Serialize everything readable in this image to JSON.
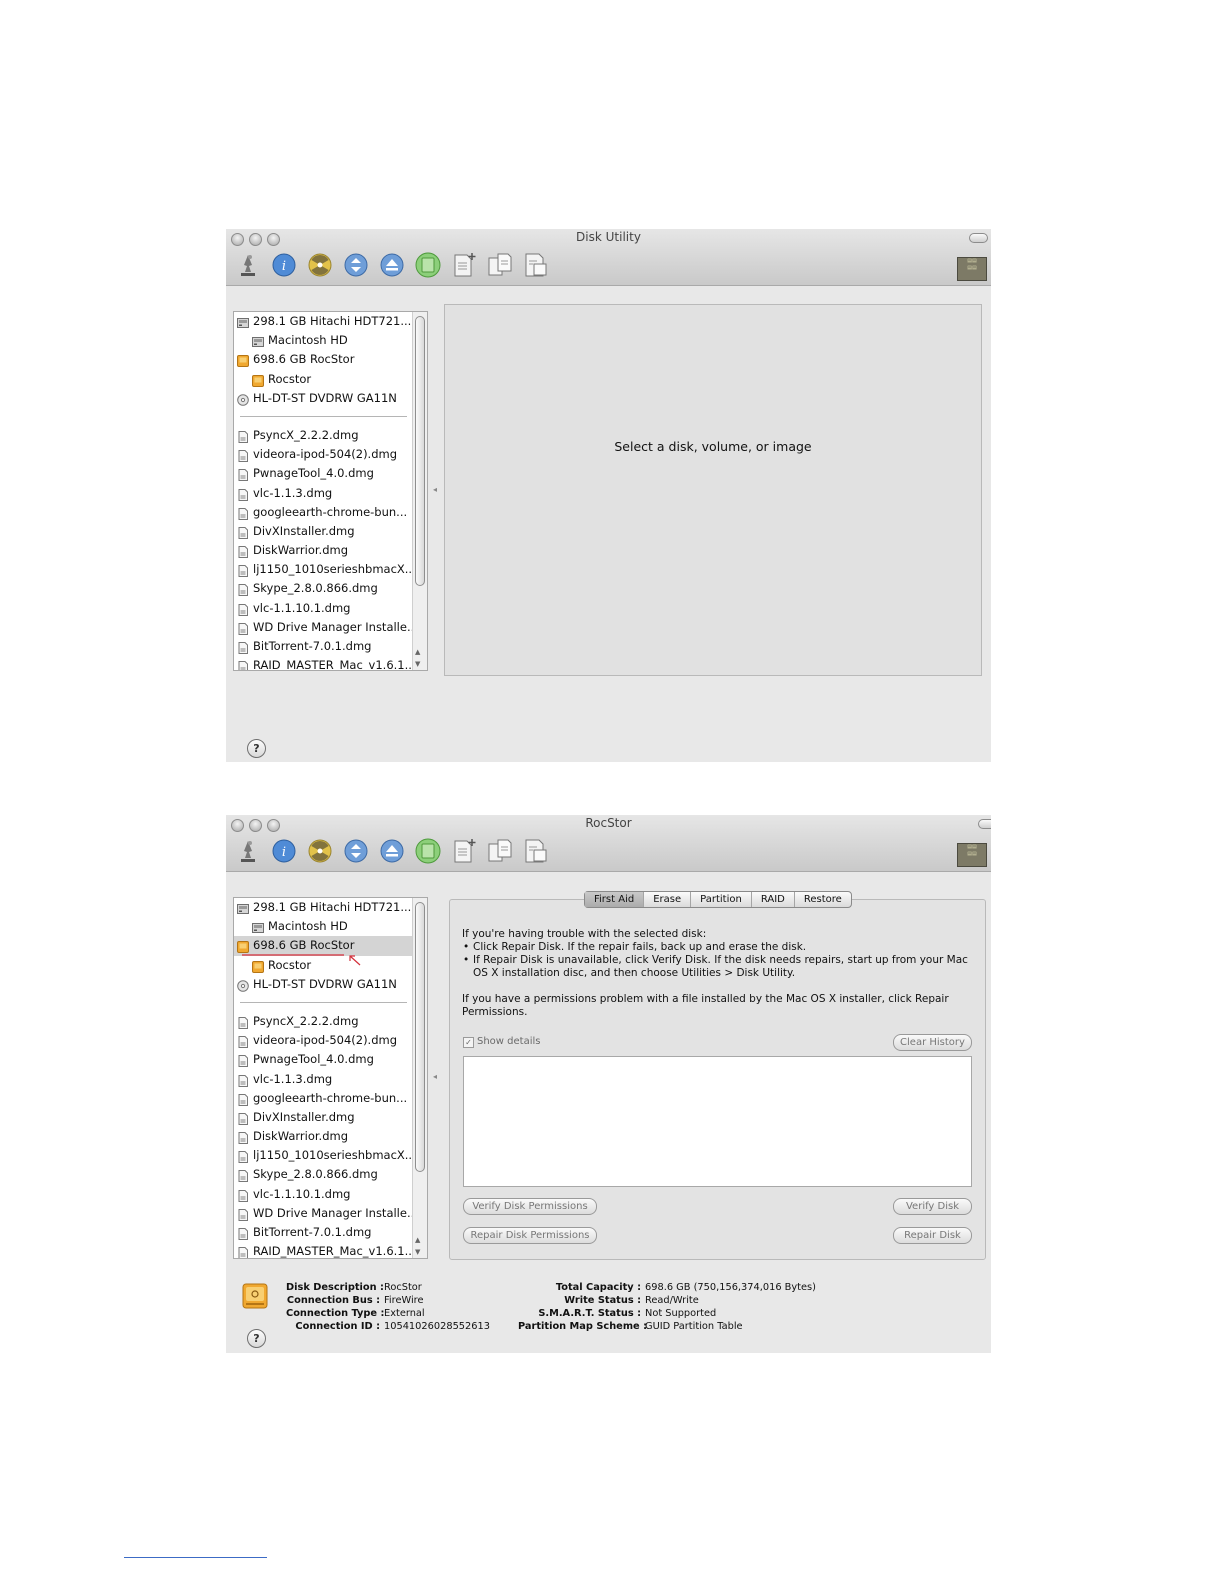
{
  "window1": {
    "title": "Disk Utility",
    "placeholder_message": "Select a disk, volume, or image"
  },
  "window2": {
    "title": "RocStor",
    "tabs": [
      "First Aid",
      "Erase",
      "Partition",
      "RAID",
      "Restore"
    ],
    "active_tab": "First Aid",
    "first_aid": {
      "intro_heading": "If you're having trouble with the selected disk:",
      "bullets": [
        "Click Repair Disk. If the repair fails, back up and erase the disk.",
        "If Repair Disk is unavailable, click Verify Disk. If the disk needs repairs, start up from your Mac OS X installation disc, and then choose Utilities > Disk Utility."
      ],
      "permissions_note": "If you have a permissions problem with a file installed by the Mac OS X installer, click Repair Permissions.",
      "show_details_label": "Show details",
      "clear_history_label": "Clear History",
      "verify_permissions_label": "Verify Disk Permissions",
      "repair_permissions_label": "Repair Disk Permissions",
      "verify_disk_label": "Verify Disk",
      "repair_disk_label": "Repair Disk"
    },
    "info_left": [
      {
        "label": "Disk Description :",
        "value": "RocStor"
      },
      {
        "label": "Connection Bus :",
        "value": "FireWire"
      },
      {
        "label": "Connection Type :",
        "value": "External"
      },
      {
        "label": "Connection ID :",
        "value": "10541026028552613"
      }
    ],
    "info_right": [
      {
        "label": "Total Capacity :",
        "value": "698.6 GB (750,156,374,016 Bytes)"
      },
      {
        "label": "Write Status :",
        "value": "Read/Write"
      },
      {
        "label": "S.M.A.R.T. Status :",
        "value": "Not Supported"
      },
      {
        "label": "Partition Map Scheme :",
        "value": "GUID Partition Table"
      }
    ]
  },
  "sidebar": {
    "devices": [
      {
        "label": "298.1 GB Hitachi HDT721...",
        "icon": "internal-disk-icon",
        "indent": 0
      },
      {
        "label": "Macintosh HD",
        "icon": "internal-disk-icon",
        "indent": 1
      },
      {
        "label": "698.6 GB RocStor",
        "icon": "external-disk-icon",
        "indent": 0
      },
      {
        "label": "Rocstor",
        "icon": "external-disk-icon",
        "indent": 1
      },
      {
        "label": "HL-DT-ST DVDRW GA11N",
        "icon": "optical-drive-icon",
        "indent": 0
      }
    ],
    "images": [
      "PsyncX_2.2.2.dmg",
      "videora-ipod-504(2).dmg",
      "PwnageTool_4.0.dmg",
      "vlc-1.1.3.dmg",
      "googleearth-chrome-bun...",
      "DivXInstaller.dmg",
      "DiskWarrior.dmg",
      "lj1150_1010serieshbmacX...",
      "Skype_2.8.0.866.dmg",
      "vlc-1.1.10.1.dmg",
      "WD Drive Manager Installe...",
      "BitTorrent-7.0.1.dmg",
      "RAID_MASTER_Mac_v1.6.1..."
    ]
  },
  "toolbar_icons": [
    "verify-icon",
    "info-icon",
    "burn-icon",
    "mount-icon",
    "eject-icon",
    "enable-journaling-icon",
    "new-image-icon",
    "convert-icon",
    "resize-image-icon"
  ],
  "help_label": "?",
  "colors": {
    "window_bg": "#e8e8e8",
    "selection": "#d4d4d4",
    "annotation": "#d32f3a",
    "external_disk": "#f0a830"
  }
}
